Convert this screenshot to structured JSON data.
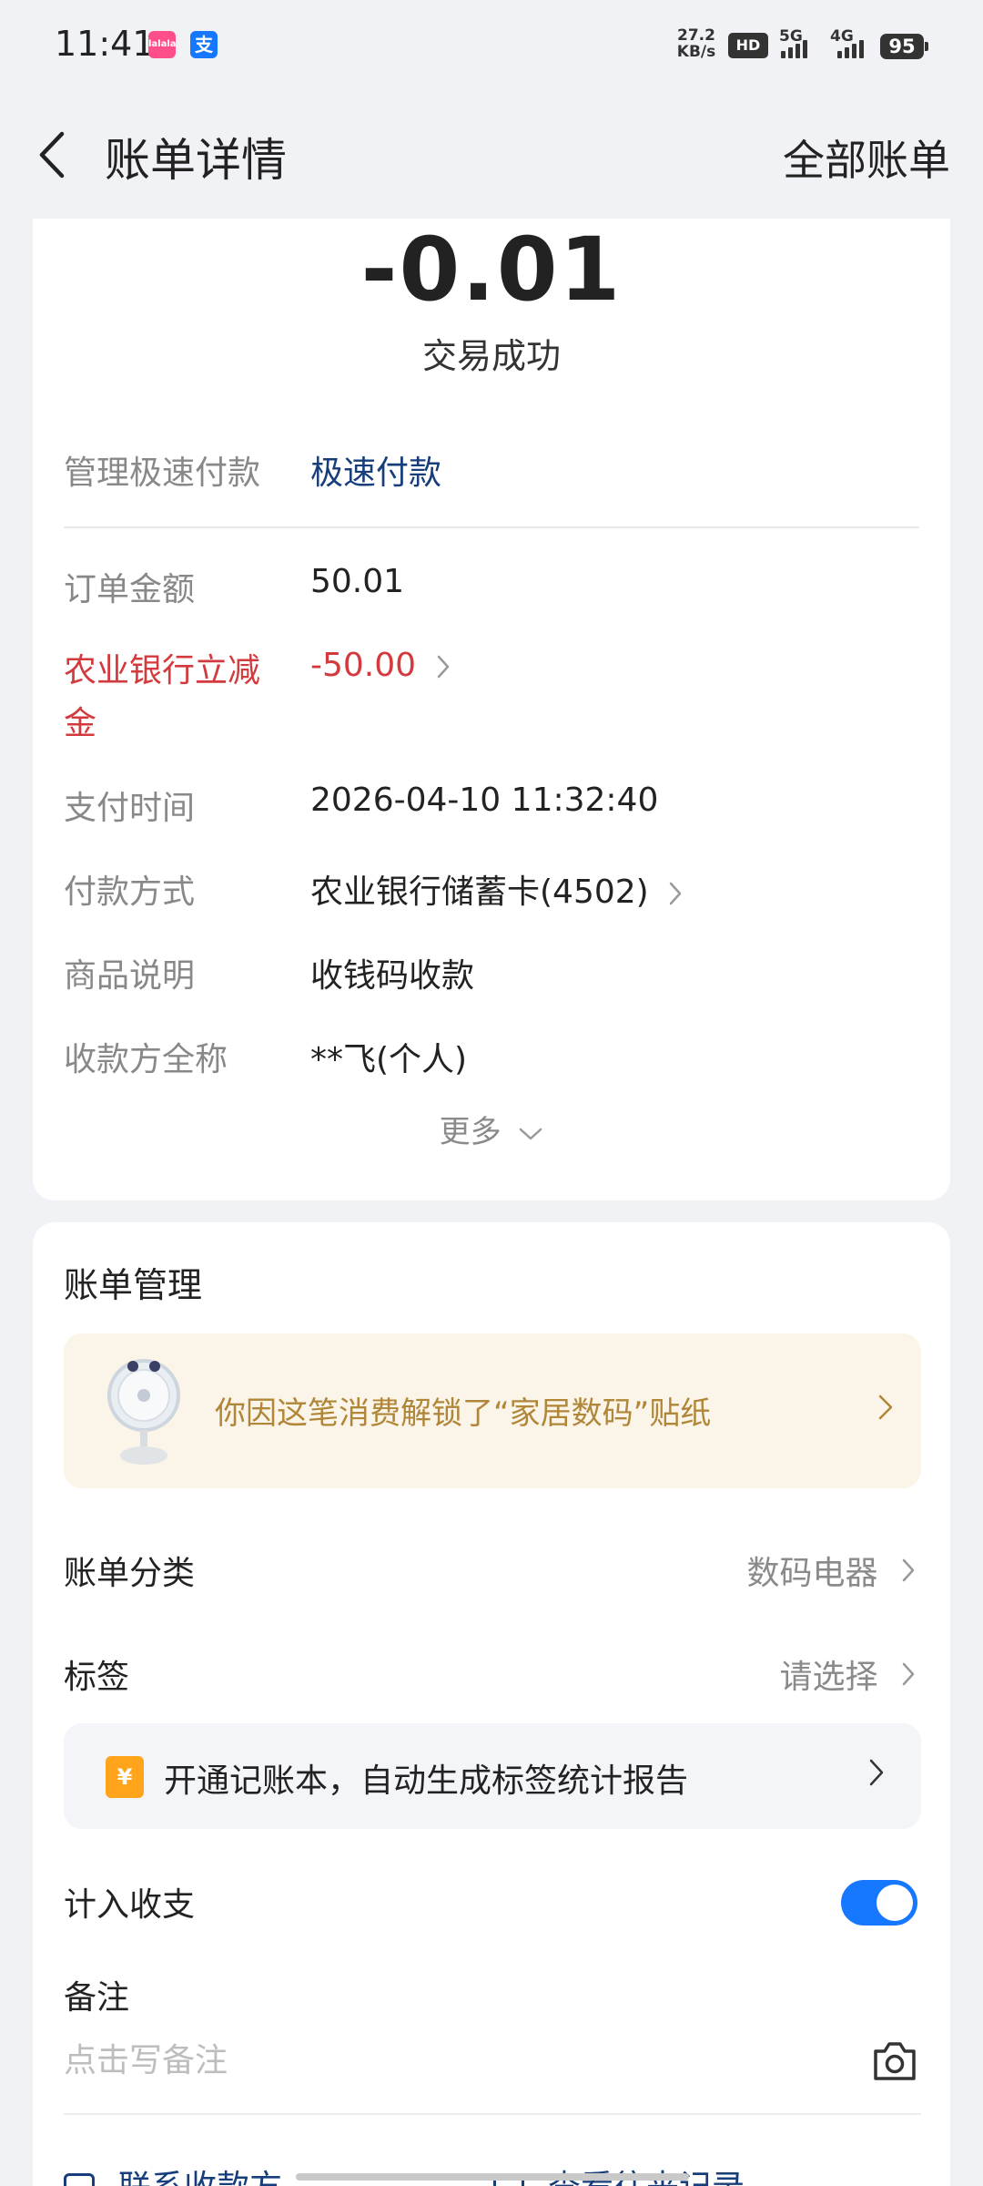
{
  "status_bar": {
    "time": "11:41",
    "app_badge_1": "lalala",
    "app_badge_2": "支",
    "net_speed_value": "27.2",
    "net_speed_unit": "KB/s",
    "hd_label": "HD",
    "net_5g": "5G",
    "net_4g": "4G",
    "battery": "95"
  },
  "header": {
    "title": "账单详情",
    "right_action": "全部账单"
  },
  "summary": {
    "amount": "-0.01",
    "status": "交易成功"
  },
  "details": {
    "manage_label": "管理极速付款",
    "manage_value": "极速付款",
    "order_amount_label": "订单金额",
    "order_amount_value": "50.01",
    "discount_label_line1": "农业银行立减",
    "discount_label_line2": "金",
    "discount_value": "-50.00",
    "pay_time_label": "支付时间",
    "pay_time_value": "2026-04-10 11:32:40",
    "pay_method_label": "付款方式",
    "pay_method_value": "农业银行储蓄卡(4502)",
    "goods_label": "商品说明",
    "goods_value": "收钱码收款",
    "payee_label": "收款方全称",
    "payee_value": "**飞(个人)",
    "more_label": "更多"
  },
  "management": {
    "title": "账单管理",
    "sticker_text": "你因这笔消费解锁了“家居数码”贴纸",
    "category_label": "账单分类",
    "category_value": "数码电器",
    "tag_label": "标签",
    "tag_value": "请选择",
    "promo_icon": "¥",
    "promo_text": "开通记账本，自动生成标签统计报告",
    "include_label": "计入收支",
    "include_enabled": true,
    "note_label": "备注",
    "note_placeholder": "点击写备注",
    "contact_label": "联系收款方",
    "history_label": "查看往来记录"
  },
  "colors": {
    "accent_blue": "#1677ff",
    "link_blue": "#173e7a",
    "discount_red": "#d33a3e",
    "sticker_text": "#b08638"
  }
}
